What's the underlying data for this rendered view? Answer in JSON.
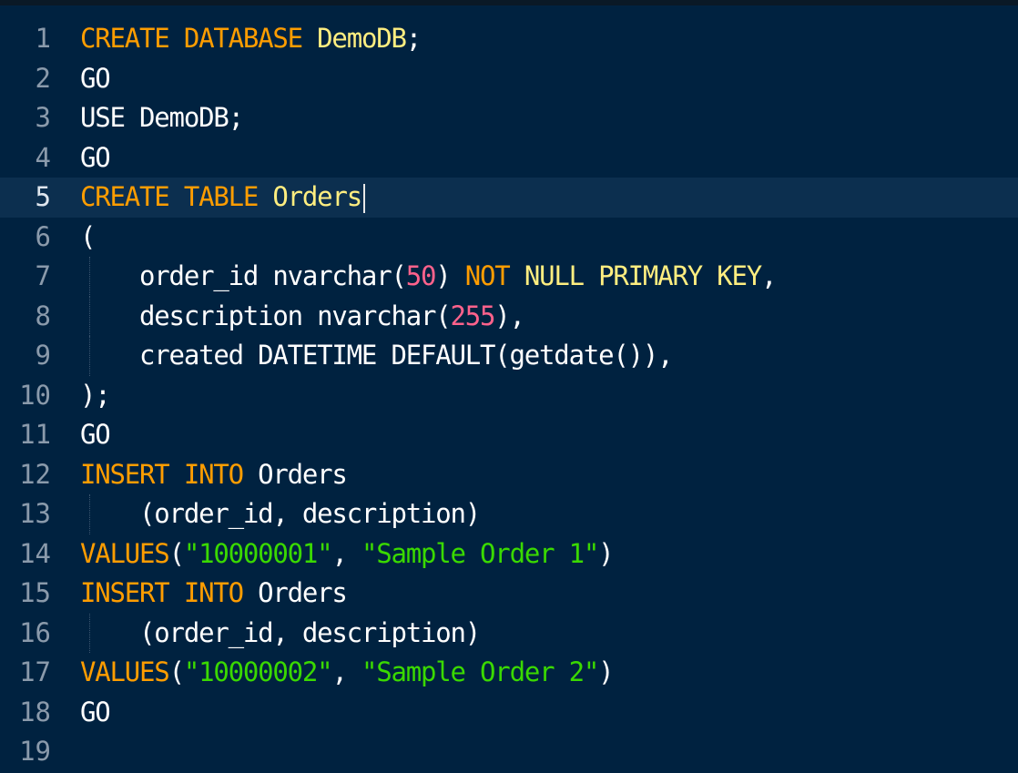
{
  "editor": {
    "language": "sql",
    "active_line": 5,
    "colors": {
      "background": "#002240",
      "active_line": "#0c2f4f",
      "keyword": "#ff9d00",
      "type_name": "#ffee80",
      "number": "#ff628c",
      "string": "#3ad900",
      "line_number": "#8a9aab"
    },
    "lines": [
      {
        "n": "1",
        "tokens": [
          {
            "t": "CREATE",
            "c": "kw"
          },
          {
            "t": " ",
            "c": "pn"
          },
          {
            "t": "DATABASE",
            "c": "kw"
          },
          {
            "t": " ",
            "c": "pn"
          },
          {
            "t": "DemoDB",
            "c": "ty"
          },
          {
            "t": ";",
            "c": "pn"
          }
        ]
      },
      {
        "n": "2",
        "tokens": [
          {
            "t": "GO",
            "c": "id"
          }
        ]
      },
      {
        "n": "3",
        "tokens": [
          {
            "t": "USE DemoDB;",
            "c": "id"
          }
        ]
      },
      {
        "n": "4",
        "tokens": [
          {
            "t": "GO",
            "c": "id"
          }
        ]
      },
      {
        "n": "5",
        "tokens": [
          {
            "t": "CREATE",
            "c": "kw"
          },
          {
            "t": " ",
            "c": "pn"
          },
          {
            "t": "TABLE",
            "c": "kw"
          },
          {
            "t": " ",
            "c": "pn"
          },
          {
            "t": "Orders",
            "c": "ty"
          }
        ]
      },
      {
        "n": "6",
        "tokens": [
          {
            "t": "(",
            "c": "pn"
          }
        ]
      },
      {
        "n": "7",
        "tokens": [
          {
            "t": "    order_id nvarchar(",
            "c": "id"
          },
          {
            "t": "50",
            "c": "num"
          },
          {
            "t": ") ",
            "c": "pn"
          },
          {
            "t": "NOT",
            "c": "kw"
          },
          {
            "t": " ",
            "c": "pn"
          },
          {
            "t": "NULL",
            "c": "ty"
          },
          {
            "t": " ",
            "c": "pn"
          },
          {
            "t": "PRIMARY KEY",
            "c": "ty"
          },
          {
            "t": ",",
            "c": "pn"
          }
        ]
      },
      {
        "n": "8",
        "tokens": [
          {
            "t": "    description nvarchar(",
            "c": "id"
          },
          {
            "t": "255",
            "c": "num"
          },
          {
            "t": "),",
            "c": "pn"
          }
        ]
      },
      {
        "n": "9",
        "tokens": [
          {
            "t": "    created DATETIME DEFAULT(getdate()),",
            "c": "id"
          }
        ]
      },
      {
        "n": "10",
        "tokens": [
          {
            "t": ");",
            "c": "pn"
          }
        ]
      },
      {
        "n": "11",
        "tokens": [
          {
            "t": "GO",
            "c": "id"
          }
        ]
      },
      {
        "n": "12",
        "tokens": [
          {
            "t": "INSERT",
            "c": "kw"
          },
          {
            "t": " ",
            "c": "pn"
          },
          {
            "t": "INTO",
            "c": "kw"
          },
          {
            "t": " Orders",
            "c": "id"
          }
        ]
      },
      {
        "n": "13",
        "tokens": [
          {
            "t": "    (order_id, description)",
            "c": "id"
          }
        ]
      },
      {
        "n": "14",
        "tokens": [
          {
            "t": "VALUES",
            "c": "kw"
          },
          {
            "t": "(",
            "c": "pn"
          },
          {
            "t": "\"10000001\"",
            "c": "str"
          },
          {
            "t": ", ",
            "c": "pn"
          },
          {
            "t": "\"Sample Order 1\"",
            "c": "str"
          },
          {
            "t": ")",
            "c": "pn"
          }
        ]
      },
      {
        "n": "15",
        "tokens": [
          {
            "t": "INSERT",
            "c": "kw"
          },
          {
            "t": " ",
            "c": "pn"
          },
          {
            "t": "INTO",
            "c": "kw"
          },
          {
            "t": " Orders",
            "c": "id"
          }
        ]
      },
      {
        "n": "16",
        "tokens": [
          {
            "t": "    (order_id, description)",
            "c": "id"
          }
        ]
      },
      {
        "n": "17",
        "tokens": [
          {
            "t": "VALUES",
            "c": "kw"
          },
          {
            "t": "(",
            "c": "pn"
          },
          {
            "t": "\"10000002\"",
            "c": "str"
          },
          {
            "t": ", ",
            "c": "pn"
          },
          {
            "t": "\"Sample Order 2\"",
            "c": "str"
          },
          {
            "t": ")",
            "c": "pn"
          }
        ]
      },
      {
        "n": "18",
        "tokens": [
          {
            "t": "GO",
            "c": "id"
          }
        ]
      },
      {
        "n": "19",
        "tokens": []
      }
    ]
  }
}
